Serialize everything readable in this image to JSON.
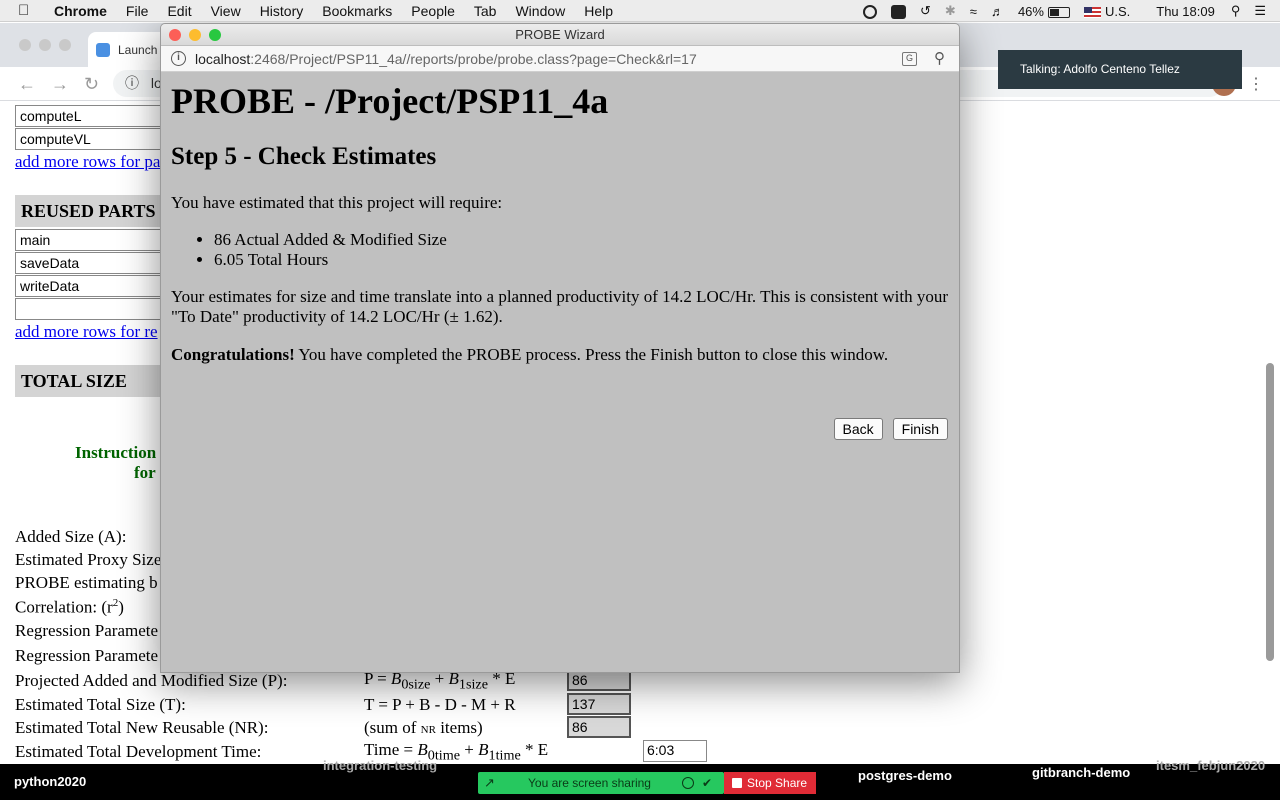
{
  "menubar": {
    "apple": "",
    "app_name": "Chrome",
    "items": [
      "File",
      "Edit",
      "View",
      "History",
      "Bookmarks",
      "People",
      "Tab",
      "Window",
      "Help"
    ],
    "battery": "46%",
    "input_source": "U.S.",
    "clock": "Thu 18:09"
  },
  "browser": {
    "tab_title": "Launch",
    "address_fragment": "lo"
  },
  "background_page": {
    "inputs_top": [
      "computeL",
      "computeVL"
    ],
    "add_rows_link_1": "add more rows for pa",
    "reused_parts_header": "REUSED PARTS",
    "reused_inputs": [
      "main",
      "saveData",
      "writeData",
      ""
    ],
    "add_rows_link_2": "add more rows for re",
    "total_size_header": "TOTAL SIZE",
    "instructions_line1": "Instruction",
    "instructions_line2": "for",
    "labels": {
      "added_size": "Added Size (A):",
      "est_proxy": "Estimated Proxy Size",
      "probe_method": "PROBE estimating b",
      "correlation": "Correlation: (r",
      "correlation_sup": "2",
      "correlation_end": ")",
      "regression1": "Regression Paramete",
      "regression2": "Regression Paramete",
      "projected": "Projected Added and Modified Size (P):",
      "total_size": "Estimated Total Size (T):",
      "new_reusable": "Estimated Total New Reusable (NR):",
      "dev_time": "Estimated Total Development Time:"
    },
    "formulas": {
      "p_pre": "P = ",
      "p_b0": "B",
      "p_b0_sub": "0size",
      "p_plus": " + ",
      "p_b1": "B",
      "p_b1_sub": "1size",
      "p_end": " * E",
      "t": "T = P + B - D - M + R",
      "nr_pre": "(sum of ",
      "nr_small": "NR",
      "nr_end": " items)",
      "time_pre": "Time = ",
      "time_b0": "B",
      "time_b0_sub": "0time",
      "time_plus": " + ",
      "time_b1": "B",
      "time_b1_sub": "1time",
      "time_end": " * E"
    },
    "values": {
      "projected": "86",
      "total_size": "137",
      "new_reusable": "86",
      "dev_time": "6:03"
    }
  },
  "talking": "Talking: Adolfo Centeno Tellez",
  "dock": {
    "python": "python2020",
    "integration": "integration-testing",
    "postgres": "postgres-demo",
    "gitbranch": "gitbranch-demo",
    "itesm": "itesm_febjun2020",
    "sharing": "You are screen sharing",
    "stop_share": "Stop Share"
  },
  "probe": {
    "window_title": "PROBE Wizard",
    "url_host": "localhost",
    "url_rest": ":2468/Project/PSP11_4a//reports/probe/probe.class?page=Check&rl=17",
    "heading": "PROBE - /Project/PSP11_4a",
    "step": "Step 5 - Check Estimates",
    "intro": "You have estimated that this project will require:",
    "bullets": [
      "86 Actual Added & Modified Size",
      "6.05 Total Hours"
    ],
    "translate_text": "Your estimates for size and time translate into a planned productivity of 14.2 LOC/Hr. This is consistent with your \"To Date\" productivity of 14.2 LOC/Hr (± 1.62).",
    "congrats_bold": "Congratulations!",
    "congrats_text": " You have completed the PROBE process. Press the Finish button to close this window.",
    "back_label": "Back",
    "finish_label": "Finish"
  },
  "colors": {
    "dialog_bg": "#c0c0c0",
    "link": "#0000ee",
    "instructions": "#006400",
    "share_green": "#26c85f",
    "stop_red": "#e02b36",
    "talking_bg": "#2b3a42"
  }
}
